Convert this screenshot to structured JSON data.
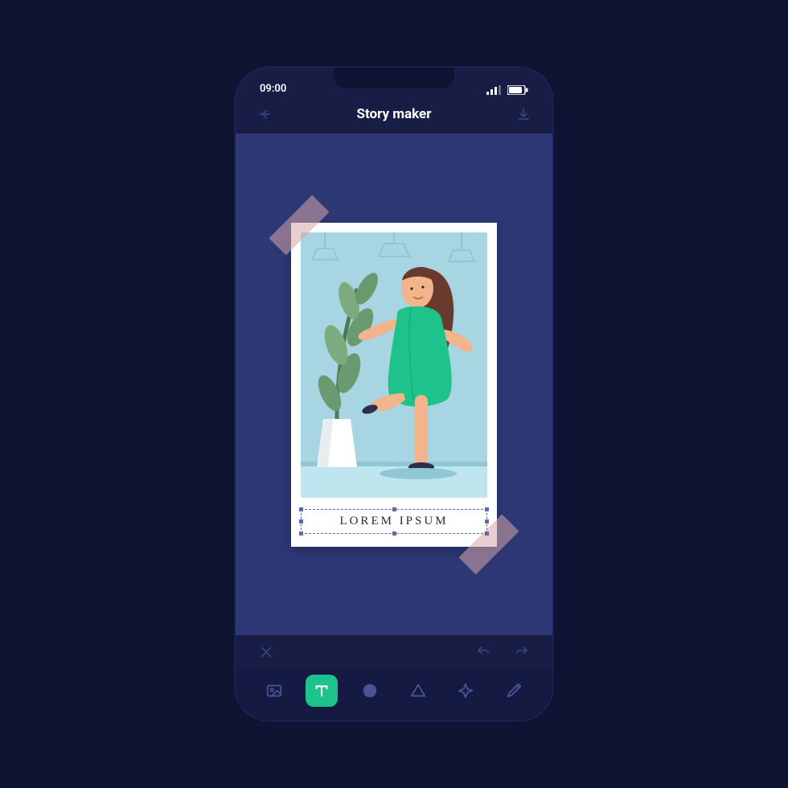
{
  "status": {
    "time": "09:00"
  },
  "header": {
    "title": "Story maker",
    "back_icon": "back",
    "download_icon": "download"
  },
  "canvas": {
    "caption_text": "LOREM IPSUM",
    "image_alt": "Woman in green dress dancing next to potted plant"
  },
  "subbar": {
    "close_icon": "close",
    "undo_icon": "undo",
    "redo_icon": "redo"
  },
  "tools": [
    {
      "name": "image",
      "label": "Image",
      "active": false
    },
    {
      "name": "text",
      "label": "Text",
      "active": true
    },
    {
      "name": "sticker",
      "label": "Sticker",
      "active": false
    },
    {
      "name": "shape",
      "label": "Shape",
      "active": false
    },
    {
      "name": "effects",
      "label": "Effects",
      "active": false
    },
    {
      "name": "color-picker",
      "label": "Color picker",
      "active": false
    }
  ],
  "colors": {
    "accent": "#1ec28b",
    "panel": "#2e3875",
    "frame": "#171d45"
  }
}
